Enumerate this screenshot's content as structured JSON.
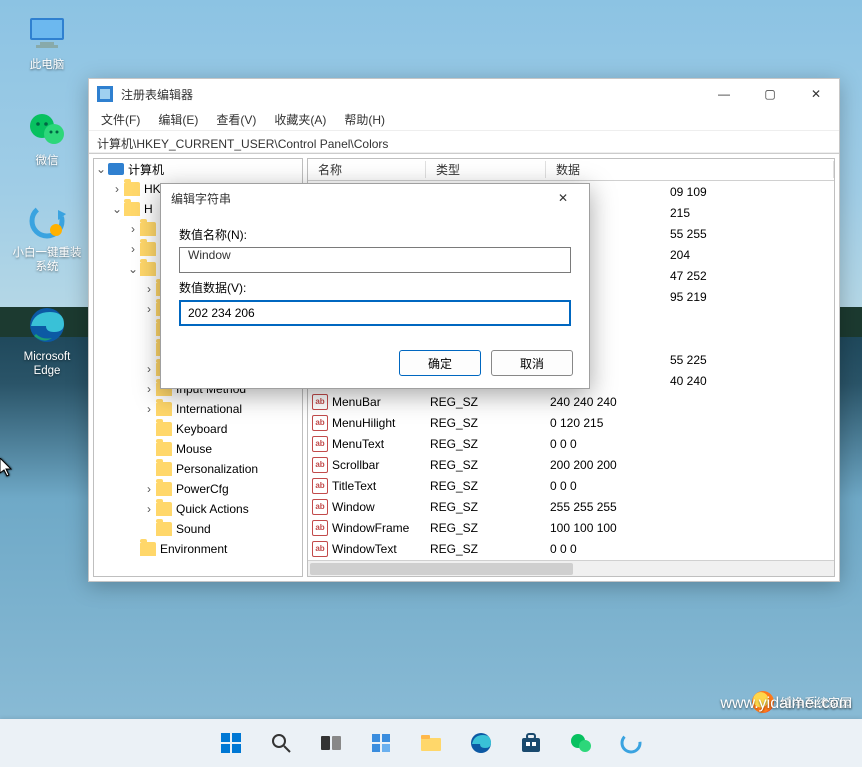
{
  "desktop": {
    "icons": [
      {
        "name": "this-pc",
        "label": "此电脑"
      },
      {
        "name": "wechat",
        "label": "微信"
      },
      {
        "name": "reinstall",
        "label": "小白一键重装\n系统"
      },
      {
        "name": "edge",
        "label": "Microsoft\nEdge"
      }
    ]
  },
  "window": {
    "title": "注册表编辑器",
    "menu": [
      "文件(F)",
      "编辑(E)",
      "查看(V)",
      "收藏夹(A)",
      "帮助(H)"
    ],
    "address": "计算机\\HKEY_CURRENT_USER\\Control Panel\\Colors",
    "columns": {
      "name": "名称",
      "type": "类型",
      "data": "数据"
    },
    "tree": {
      "root": "计算机",
      "visible_upper": [
        {
          "label": "HKEY_CLASSES_ROOT",
          "indent": 1,
          "arrow": ">"
        },
        {
          "label": "H",
          "indent": 1,
          "arrow": "v"
        },
        {
          "label": "",
          "indent": 2,
          "arrow": ">"
        },
        {
          "label": "",
          "indent": 2,
          "arrow": ">"
        },
        {
          "label": "",
          "indent": 2,
          "arrow": "v"
        },
        {
          "label": "",
          "indent": 3,
          "arrow": ">"
        },
        {
          "label": "",
          "indent": 3,
          "arrow": ">"
        },
        {
          "label": "",
          "indent": 3,
          "arrow": ""
        },
        {
          "label": "",
          "indent": 3,
          "arrow": ""
        },
        {
          "label": "",
          "indent": 3,
          "arrow": ">"
        }
      ],
      "visible_lower": [
        {
          "label": "Input Method",
          "indent": 3,
          "arrow": ">"
        },
        {
          "label": "International",
          "indent": 3,
          "arrow": ">"
        },
        {
          "label": "Keyboard",
          "indent": 3,
          "arrow": ""
        },
        {
          "label": "Mouse",
          "indent": 3,
          "arrow": ""
        },
        {
          "label": "Personalization",
          "indent": 3,
          "arrow": ""
        },
        {
          "label": "PowerCfg",
          "indent": 3,
          "arrow": ">"
        },
        {
          "label": "Quick Actions",
          "indent": 3,
          "arrow": ">"
        },
        {
          "label": "Sound",
          "indent": 3,
          "arrow": ""
        },
        {
          "label": "Environment",
          "indent": 2,
          "arrow": ""
        }
      ]
    },
    "partial_rows": [
      {
        "data": "09 109"
      },
      {
        "data": "215"
      },
      {
        "data": "55 255"
      },
      {
        "data": "204"
      },
      {
        "data": "47 252"
      },
      {
        "data": "95 219"
      },
      {
        "data": ""
      },
      {
        "data": ""
      },
      {
        "data": "55 225"
      },
      {
        "data": "40 240"
      }
    ],
    "rows": [
      {
        "name": "MenuBar",
        "type": "REG_SZ",
        "data": "240 240 240"
      },
      {
        "name": "MenuHilight",
        "type": "REG_SZ",
        "data": "0 120 215"
      },
      {
        "name": "MenuText",
        "type": "REG_SZ",
        "data": "0 0 0"
      },
      {
        "name": "Scrollbar",
        "type": "REG_SZ",
        "data": "200 200 200"
      },
      {
        "name": "TitleText",
        "type": "REG_SZ",
        "data": "0 0 0"
      },
      {
        "name": "Window",
        "type": "REG_SZ",
        "data": "255 255 255"
      },
      {
        "name": "WindowFrame",
        "type": "REG_SZ",
        "data": "100 100 100"
      },
      {
        "name": "WindowText",
        "type": "REG_SZ",
        "data": "0 0 0"
      }
    ]
  },
  "dialog": {
    "title": "编辑字符串",
    "name_label": "数值名称(N):",
    "name_value": "Window",
    "data_label": "数值数据(V):",
    "data_value": "202 234 206",
    "ok": "确定",
    "cancel": "取消"
  },
  "watermark": {
    "text": "纯净系统家园",
    "url": "www.yidaimei.com"
  },
  "taskbar": {
    "items": [
      "start",
      "search",
      "taskview",
      "widgets",
      "chat",
      "explorer",
      "edge",
      "store",
      "wechat",
      "reinstall"
    ]
  }
}
